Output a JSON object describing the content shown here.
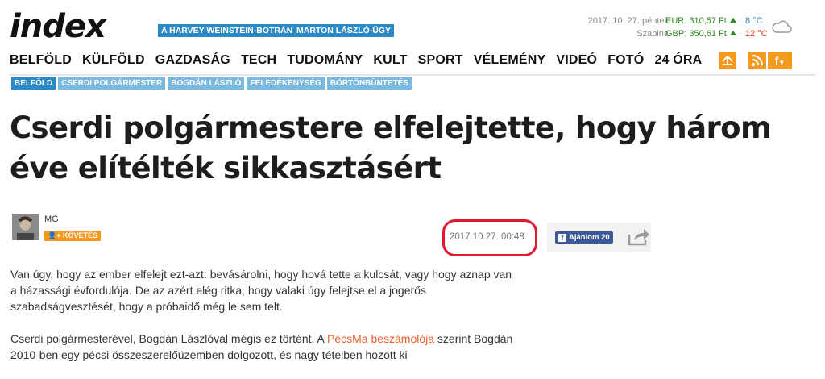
{
  "header": {
    "logo": "index",
    "hot_tags": [
      "A HARVEY WEINSTEIN-BOTRÁNY",
      "MARTON LÁSZLÓ-ÜGY"
    ],
    "date": "2017. 10. 27. péntek",
    "nameday": "Szabina",
    "eur": "EUR: 310,57 Ft",
    "gbp": "GBP: 350,61 Ft",
    "temp_min": "8 °C",
    "temp_max": "12 °C",
    "weather_icon": "cloud-icon"
  },
  "nav": {
    "items": [
      "BELFÖLD",
      "KÜLFÖLD",
      "GAZDASÁG",
      "TECH",
      "TUDOMÁNY",
      "KULT",
      "SPORT",
      "VÉLEMÉNY",
      "VIDEÓ",
      "FOTÓ",
      "24 ÓRA"
    ],
    "icons": [
      "inbox-icon",
      "rss-icon",
      "facebook-icon"
    ],
    "fb_label": "f"
  },
  "article": {
    "categories": [
      "BELFÖLD",
      "CSERDI POLGÁRMESTER",
      "BOGDÁN LÁSZLÓ",
      "FELEDÉKENYSÉG",
      "BÖRTÖNBÜNTETÉS"
    ],
    "title": "Cserdi polgármestere elfelejtette, hogy három éve elítélték sikkasztásért",
    "author": "MG",
    "follow_label": "KÖVETÉS",
    "timestamp": "2017.10.27. 00:48",
    "fb_share_label": "Ajánlom 20",
    "paragraph1": "Van úgy, hogy az ember elfelejt ezt-azt: bevásárolni, hogy hová tette a kulcsát, vagy hogy aznap van a házassági évfordulója. De az azért elég ritka, hogy valaki úgy felejtse el a jogerős szabadságvesztését, hogy a próbaidő még le sem telt.",
    "paragraph2_a": "Cserdi polgármesterével, Bogdán Lászlóval mégis ez történt. A ",
    "paragraph2_link": "PécsMa beszámolója",
    "paragraph2_b": " szerint Bogdán 2010-ben egy pécsi összeszerelőüzemben dolgozott, és nagy tételben hozott ki"
  },
  "colors": {
    "accent": "#2a89c6",
    "orange": "#f39a1f",
    "green": "#2c8b1e",
    "highlight": "#e0192e"
  }
}
